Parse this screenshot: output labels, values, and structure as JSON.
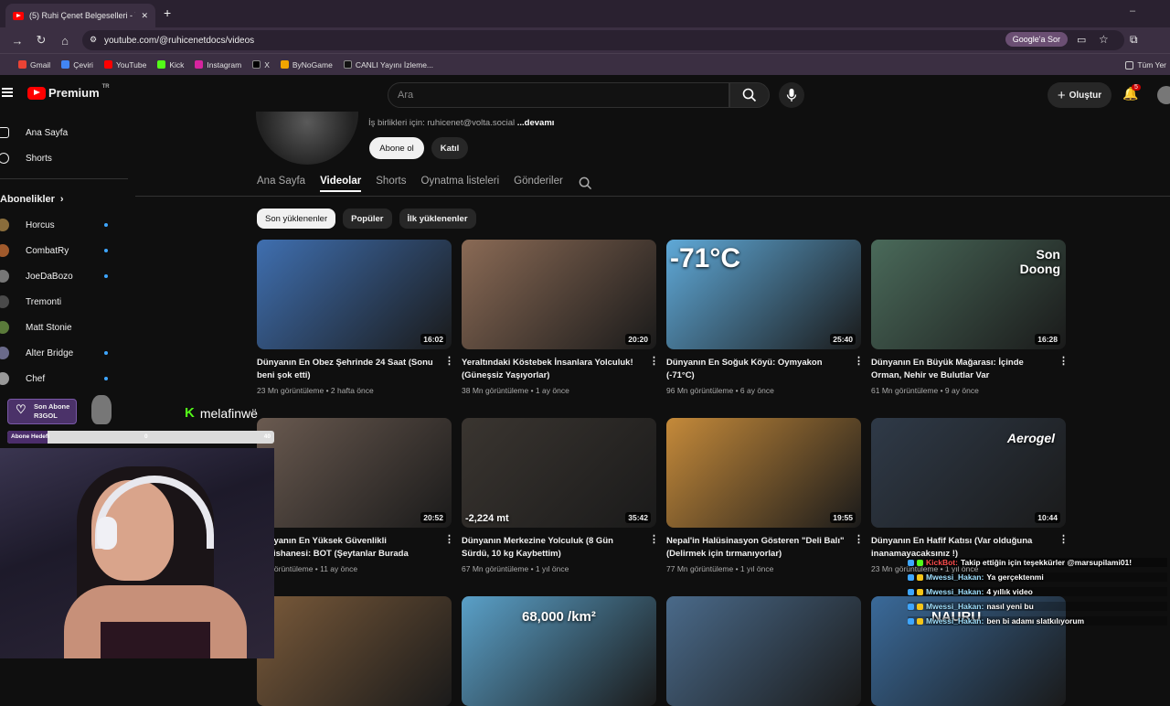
{
  "browser": {
    "tab_title": "(5) Ruhi Çenet Belgeselleri - Yo",
    "url": "youtube.com/@ruhicenetdocs/videos",
    "google_label": "Google'a Sor",
    "bookmarks": [
      "Gmail",
      "Çeviri",
      "YouTube",
      "Kick",
      "Instagram",
      "X",
      "ByNoGame",
      "CANLI Yayını İzleme..."
    ],
    "all_bookmarks": "Tüm Yer"
  },
  "youtube": {
    "logo": "Premium",
    "logo_sup": "TR",
    "search_placeholder": "Ara",
    "create": "Oluştur",
    "notif_count": "5",
    "sidebar": {
      "home": "Ana Sayfa",
      "shorts": "Shorts",
      "subs_header": "Abonelikler",
      "channels": [
        "Horcus",
        "CombatRy",
        "JoeDaBozo",
        "Tremonti",
        "Matt Stonie",
        "Alter Bridge",
        "Chef"
      ],
      "avatar_colors": [
        "#8a6d3b",
        "#a05a2c",
        "#777777",
        "#4a4a4a",
        "#5a7a3a",
        "#6a6a8a",
        "#999999"
      ]
    },
    "channel": {
      "business": "İş birlikleri için: ruhicenet@volta.social",
      "more": "...devamı",
      "subscribe": "Abone ol",
      "join": "Katıl",
      "tabs": [
        "Ana Sayfa",
        "Videolar",
        "Shorts",
        "Oynatma listeleri",
        "Gönderiler"
      ],
      "chips": [
        "Son yüklenenler",
        "Popüler",
        "İlk yüklenenler"
      ]
    },
    "videos": [
      {
        "title": "Dünyanın En Obez Şehrinde 24 Saat (Sonu beni şok etti)",
        "meta": "23 Mn görüntüleme • 2 hafta önce",
        "duration": "16:02",
        "overlay": "",
        "bg": "#3f6fb0"
      },
      {
        "title": "Yeraltındaki Köstebek İnsanlara Yolculuk! (Güneşsiz Yaşıyorlar)",
        "meta": "38 Mn görüntüleme • 1 ay önce",
        "duration": "20:20",
        "overlay": "",
        "bg": "#8a6a55"
      },
      {
        "title": "Dünyanın En Soğuk Köyü: Oymyakon (-71°C)",
        "meta": "96 Mn görüntüleme • 6 ay önce",
        "duration": "25:40",
        "overlay": "-71°C",
        "bg": "#5fa9d8"
      },
      {
        "title": "Dünyanın En Büyük Mağarası: İçinde Orman, Nehir ve Bulutlar Var",
        "meta": "61 Mn görüntüleme • 9 ay önce",
        "duration": "16:28",
        "overlay": "Son Doong",
        "bg": "#4a6a5a"
      },
      {
        "title": "Dünyanın En Yüksek Güvenlikli Hapishanesi: BOT (Şeytanlar Burada Tutuluyor)",
        "meta": "Mn görüntüleme • 11 ay önce",
        "duration": "20:52",
        "overlay": "",
        "bg": "#6a5a50"
      },
      {
        "title": "Dünyanın Merkezine Yolculuk (8 Gün Sürdü, 10 kg Kaybettim)",
        "meta": "67 Mn görüntüleme • 1 yıl önce",
        "duration": "35:42",
        "overlay": "-2,224 mt",
        "bg": "#3a3530"
      },
      {
        "title": "Nepal'in Halüsinasyon Gösteren \"Deli Balı\" (Delirmek için tırmanıyorlar)",
        "meta": "77 Mn görüntüleme • 1 yıl önce",
        "duration": "19:55",
        "overlay": "",
        "bg": "#c58a3a"
      },
      {
        "title": "Dünyanın En Hafif Katısı (Var olduğuna inanamayacaksınız !)",
        "meta": "23 Mn görüntüleme • 1 yıl önce",
        "duration": "10:44",
        "overlay": "Aerogel",
        "bg": "#2f3a48"
      },
      {
        "title": "",
        "meta": "",
        "duration": "",
        "overlay": "",
        "bg": "#7a5a3a"
      },
      {
        "title": "",
        "meta": "",
        "duration": "",
        "overlay": "68,000 /km²",
        "bg": "#5aa0c8"
      },
      {
        "title": "",
        "meta": "",
        "duration": "",
        "overlay": "",
        "bg": "#4a6a8a"
      },
      {
        "title": "",
        "meta": "",
        "duration": "",
        "overlay": "NAURU",
        "bg": "#3a6a9a"
      }
    ]
  },
  "stream": {
    "last_sub_label": "Son Abone",
    "last_sub_name": "R3GOL",
    "sub_goal_label": "Abone Hedefi",
    "sub_goal_progress": 0.15,
    "sub_goal_current": "0",
    "sub_goal_target": "40",
    "kick_user": "melafinwë",
    "chat": [
      {
        "user": "KickBot:",
        "msg": "Takip ettiğin için teşekkürler @marsupilami01!",
        "color": "#ff4d4d"
      },
      {
        "user": "Mwessi_Hakan:",
        "msg": "Ya gerçektenmi",
        "color": "#a0e0ff"
      },
      {
        "user": "Mwessi_Hakan:",
        "msg": "4 yıllık video",
        "color": "#a0e0ff"
      },
      {
        "user": "Mwessi_Hakan:",
        "msg": "nasıl yeni bu",
        "color": "#a0e0ff"
      },
      {
        "user": "Mwessi_Hakan:",
        "msg": "ben bi adamı slatkılıyorum",
        "color": "#a0e0ff"
      }
    ]
  }
}
